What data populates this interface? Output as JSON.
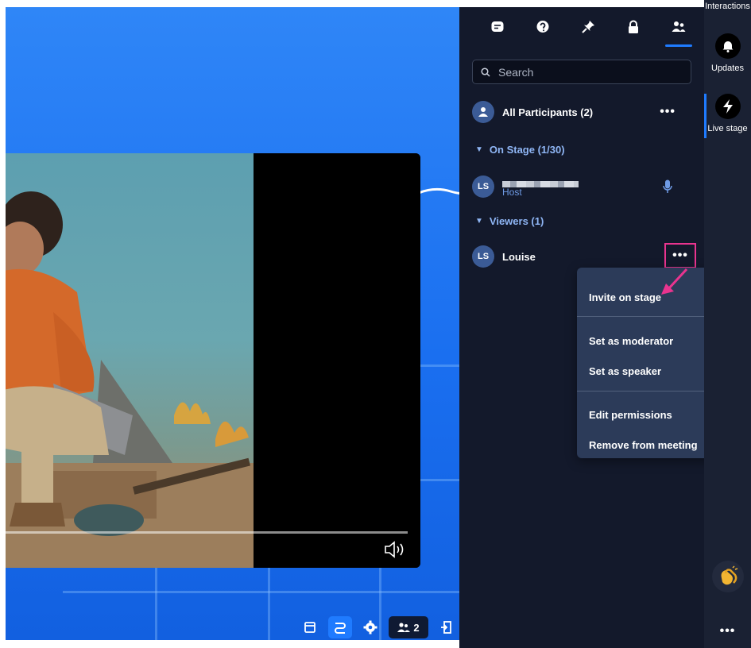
{
  "panel": {
    "tabs": [
      {
        "icon": "chat-icon"
      },
      {
        "icon": "question-icon"
      },
      {
        "icon": "pin-icon"
      },
      {
        "icon": "lock-icon"
      },
      {
        "icon": "participants-icon",
        "active": true
      }
    ],
    "search": {
      "placeholder": "Search"
    },
    "all_participants": {
      "label": "All Participants (2)"
    },
    "on_stage": {
      "label": "On Stage (1/30)"
    },
    "host": {
      "initials": "LS",
      "role": "Host"
    },
    "viewers": {
      "label": "Viewers (1)"
    },
    "louise": {
      "initials": "LS",
      "name": "Louise"
    },
    "more_glyph": "•••",
    "context_menu": {
      "invite_on_stage": "Invite on stage",
      "set_as_moderator": "Set as moderator",
      "set_as_speaker": "Set as speaker",
      "edit_permissions": "Edit permissions",
      "remove_from_meeting": "Remove from meeting"
    }
  },
  "rail": {
    "interactions": "Interactions",
    "updates": "Updates",
    "live_stage": "Live stage",
    "more_glyph": "•••"
  },
  "toolbar": {
    "participants_count": "2"
  },
  "colors": {
    "accent": "#1f7bff",
    "highlight": "#e9348f",
    "panel_bg": "#13192b",
    "menu_bg": "#2c3b59"
  }
}
